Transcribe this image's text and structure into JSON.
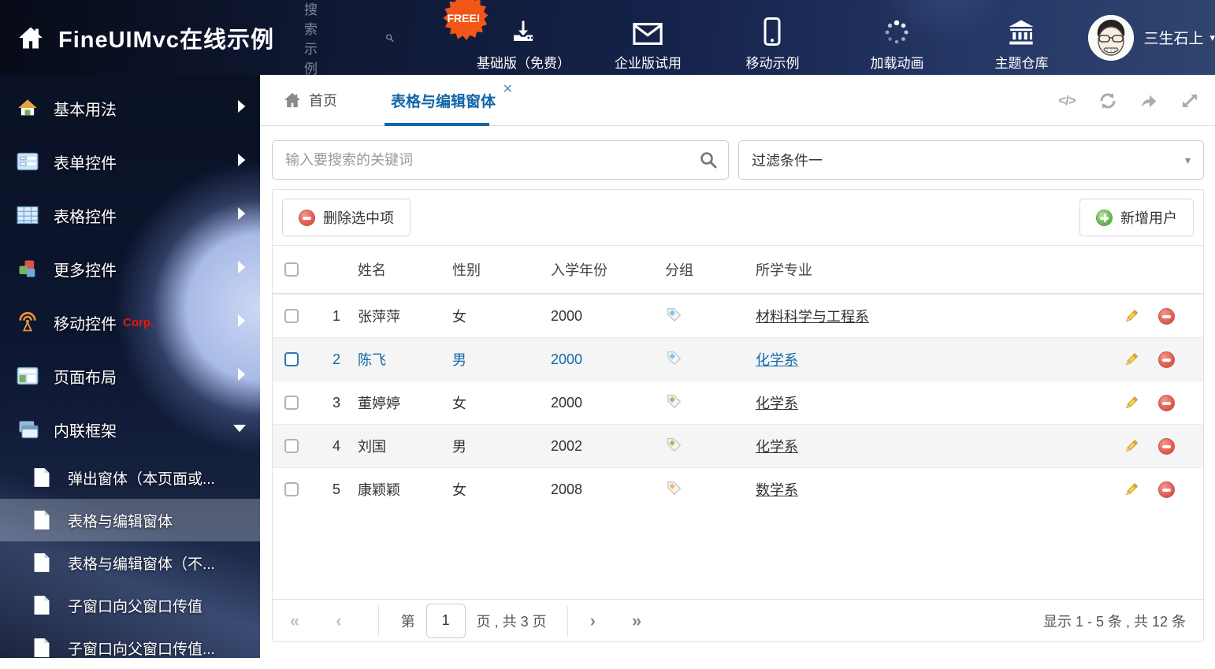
{
  "header": {
    "title": "FineUIMvc在线示例",
    "search_placeholder": "搜索示例",
    "free_badge": "FREE!",
    "nav_items": [
      {
        "label": "基础版（免费）",
        "icon": "download-icon"
      },
      {
        "label": "企业版试用",
        "icon": "envelope-icon"
      },
      {
        "label": "移动示例",
        "icon": "mobile-icon"
      },
      {
        "label": "加载动画",
        "icon": "spinner-icon"
      },
      {
        "label": "主题仓库",
        "icon": "bank-icon"
      }
    ],
    "user": {
      "name": "三生石上"
    }
  },
  "sidebar": {
    "items": [
      {
        "label": "基本用法",
        "icon": "house-icon"
      },
      {
        "label": "表单控件",
        "icon": "form-icon"
      },
      {
        "label": "表格控件",
        "icon": "grid-icon"
      },
      {
        "label": "更多控件",
        "icon": "cubes-icon"
      },
      {
        "label": "移动控件",
        "icon": "antenna-icon",
        "badge": "Corp."
      },
      {
        "label": "页面布局",
        "icon": "layout-icon"
      },
      {
        "label": "内联框架",
        "icon": "frames-icon",
        "expanded": true
      }
    ],
    "subitems": [
      {
        "label": "弹出窗体（本页面或..."
      },
      {
        "label": "表格与编辑窗体",
        "active": true
      },
      {
        "label": "表格与编辑窗体（不..."
      },
      {
        "label": "子窗口向父窗口传值"
      },
      {
        "label": "子窗口向父窗口传值..."
      }
    ]
  },
  "tabs": {
    "home": "首页",
    "active": "表格与编辑窗体"
  },
  "icons": {
    "code": "</>",
    "caret_down": "▾",
    "close": "✕"
  },
  "filters": {
    "search_placeholder": "输入要搜索的关键词",
    "dropdown_value": "过滤条件一"
  },
  "toolbar": {
    "delete_label": "删除选中项",
    "add_label": "新增用户"
  },
  "table": {
    "columns": {
      "name": "姓名",
      "gender": "性别",
      "year": "入学年份",
      "group": "分组",
      "major": "所学专业"
    },
    "tag_colors": {
      "blue": "#7fc5f2",
      "green": "#94c95e",
      "orange": "#f8b878"
    },
    "rows": [
      {
        "num": "1",
        "name": "张萍萍",
        "gender": "女",
        "year": "2000",
        "tag": "#7fc5f2",
        "major": "材料科学与工程系",
        "selected": false
      },
      {
        "num": "2",
        "name": "陈飞",
        "gender": "男",
        "year": "2000",
        "tag": "#7fc5f2",
        "major": "化学系",
        "selected": true
      },
      {
        "num": "3",
        "name": "董婷婷",
        "gender": "女",
        "year": "2000",
        "tag": "#94c95e",
        "major": "化学系",
        "selected": false
      },
      {
        "num": "4",
        "name": "刘国",
        "gender": "男",
        "year": "2002",
        "tag": "#94c95e",
        "major": "化学系",
        "selected": false
      },
      {
        "num": "5",
        "name": "康颖颖",
        "gender": "女",
        "year": "2008",
        "tag": "#f8b878",
        "major": "数学系",
        "selected": false
      }
    ]
  },
  "pagination": {
    "first": "«",
    "prev": "‹",
    "next": "›",
    "last": "»",
    "page_prefix": "第",
    "page_value": "1",
    "page_suffix": "页 , 共 3 页",
    "summary": "显示 1 - 5 条 , 共 12 条"
  },
  "colors": {
    "accent_blue": "#1166a8",
    "header_bg": "#101a36",
    "danger_red": "#e35d51",
    "success_green": "#67b857"
  }
}
